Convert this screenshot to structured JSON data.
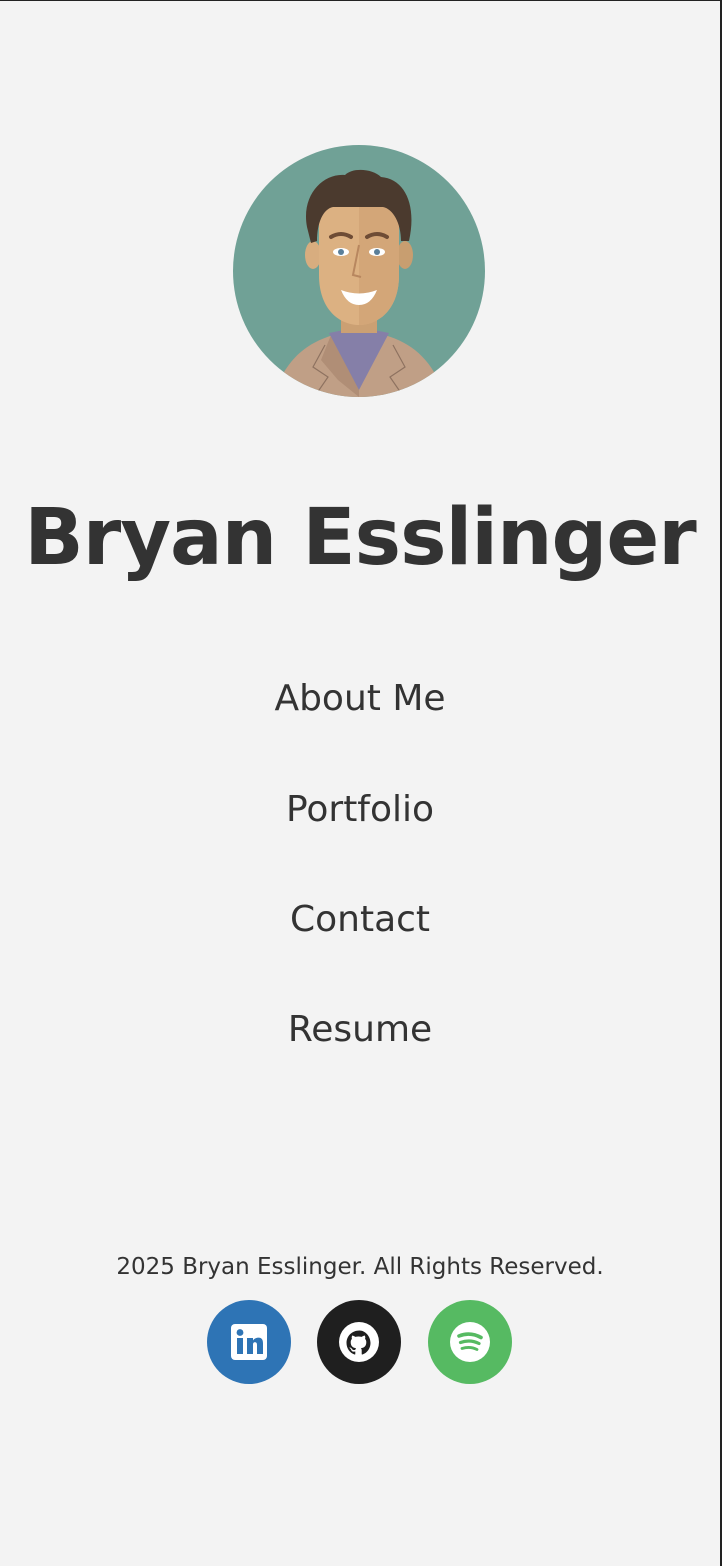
{
  "profile": {
    "avatar_icon": "cartoon-man-avatar-icon",
    "name": "Bryan Esslinger"
  },
  "nav": {
    "about": "About Me",
    "portfolio": "Portfolio",
    "contact": "Contact",
    "resume": "Resume"
  },
  "footer": {
    "copyright": "2025 Bryan Esslinger. All Rights Reserved.",
    "social": [
      {
        "name": "LinkedIn",
        "icon": "linkedin-icon",
        "color": "#2e74b5"
      },
      {
        "name": "GitHub",
        "icon": "github-icon",
        "color": "#1f1f1f"
      },
      {
        "name": "Spotify",
        "icon": "spotify-icon",
        "color": "#56ba62"
      }
    ]
  },
  "colors": {
    "background": "#f3f3f3",
    "text": "#333333",
    "avatar_bg": "#70a196"
  }
}
